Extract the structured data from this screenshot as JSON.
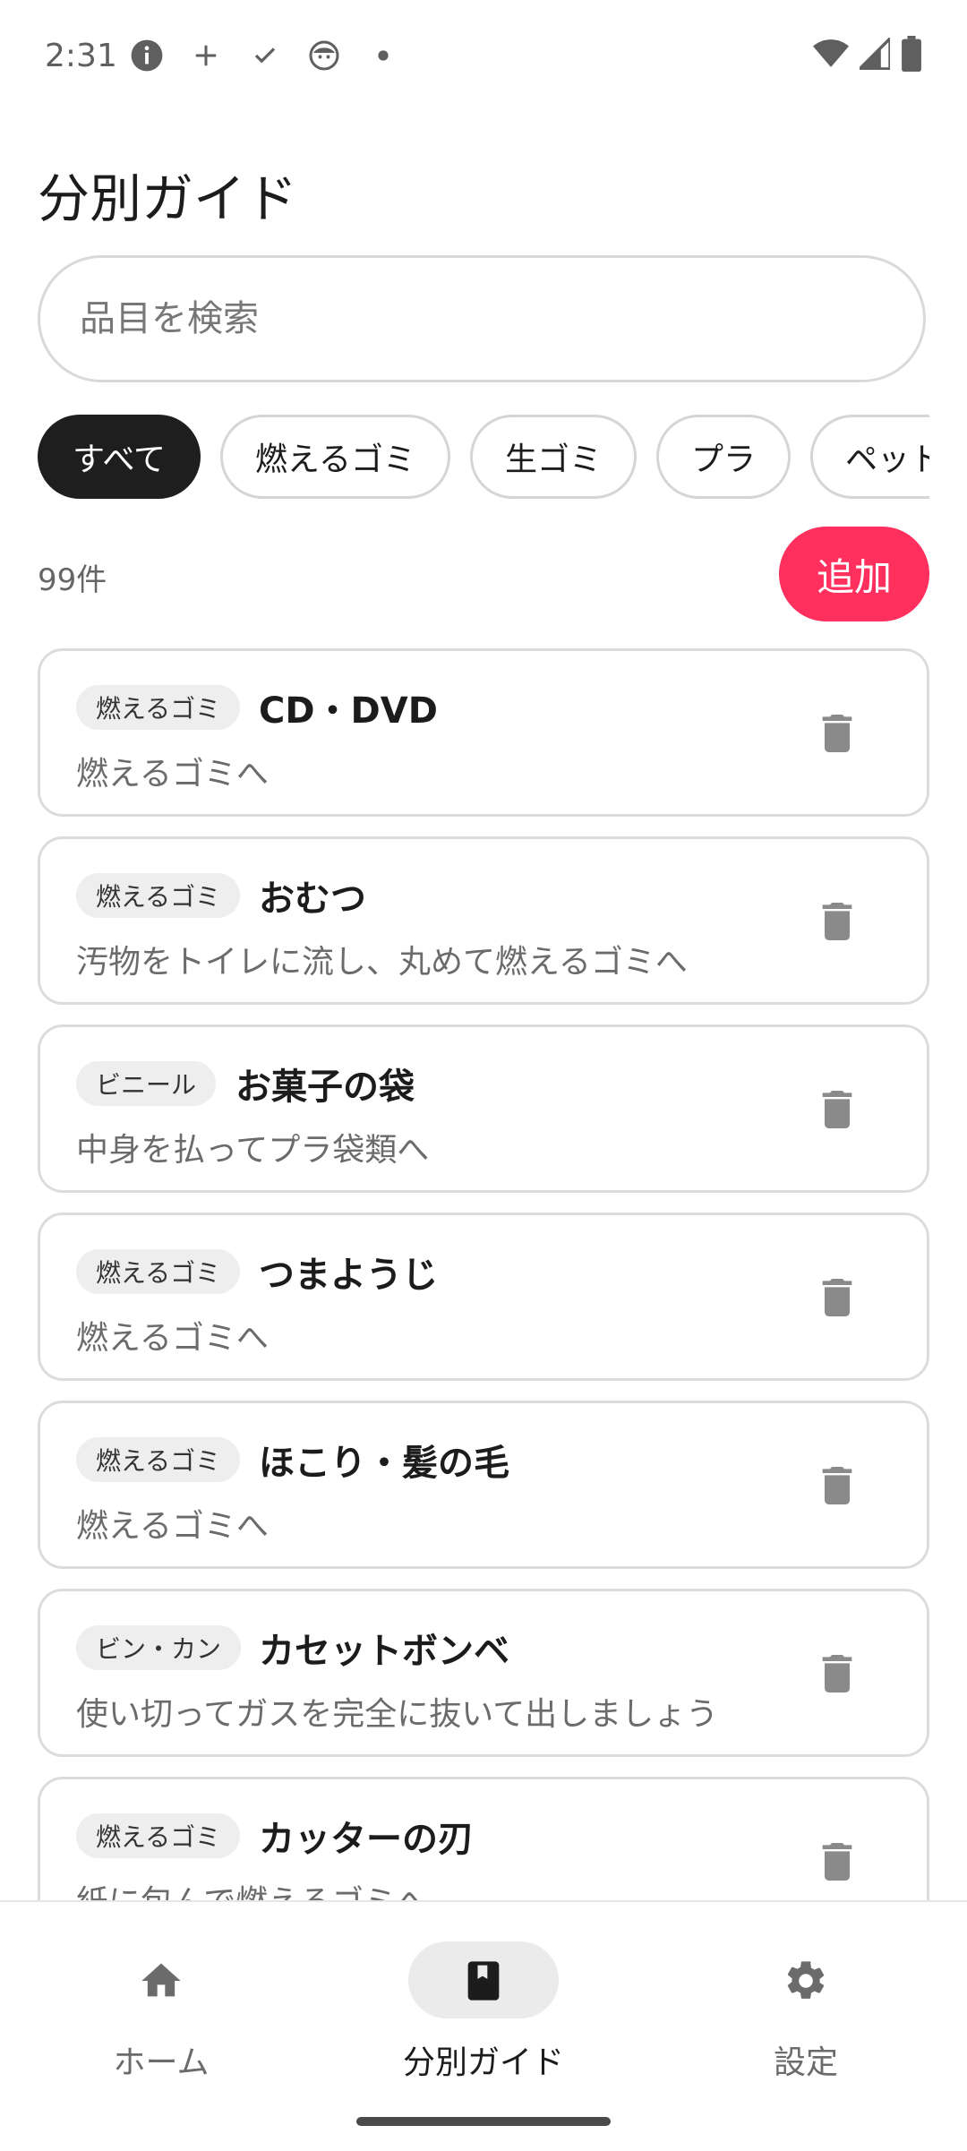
{
  "status_bar": {
    "time": "2:31",
    "left_icons": [
      "info-icon",
      "plus-icon",
      "check-icon",
      "face-icon",
      "dot-icon"
    ],
    "right_icons": [
      "wifi-icon",
      "signal-icon",
      "battery-icon"
    ]
  },
  "page": {
    "title": "分別ガイド"
  },
  "search": {
    "placeholder": "品目を検索"
  },
  "filters": [
    "すべて",
    "燃えるゴミ",
    "生ゴミ",
    "プラ",
    "ペット"
  ],
  "active_filter": "すべて",
  "count_label": "99件",
  "add_button": "追加",
  "items": [
    {
      "badge": "燃えるゴミ",
      "name": "CD・DVD",
      "desc": "燃えるゴミへ"
    },
    {
      "badge": "燃えるゴミ",
      "name": "おむつ",
      "desc": "汚物をトイレに流し、丸めて燃えるゴミへ"
    },
    {
      "badge": "ビニール",
      "name": "お菓子の袋",
      "desc": "中身を払ってプラ袋類へ"
    },
    {
      "badge": "燃えるゴミ",
      "name": "つまようじ",
      "desc": "燃えるゴミへ"
    },
    {
      "badge": "燃えるゴミ",
      "name": "ほこり・髪の毛",
      "desc": "燃えるゴミへ"
    },
    {
      "badge": "ビン・カン",
      "name": "カセットボンベ",
      "desc": "使い切ってガスを完全に抜いて出しましょう"
    },
    {
      "badge": "燃えるゴミ",
      "name": "カッターの刃",
      "desc": "紙に包んで燃えるゴミへ"
    }
  ],
  "bottom_nav": [
    {
      "label": "ホーム",
      "icon": "home-icon",
      "active": false
    },
    {
      "label": "分別ガイド",
      "icon": "book-icon",
      "active": true
    },
    {
      "label": "設定",
      "icon": "gear-icon",
      "active": false
    }
  ],
  "colors": {
    "accent": "#ff2f5e",
    "chip_active": "#1e1e1e"
  }
}
